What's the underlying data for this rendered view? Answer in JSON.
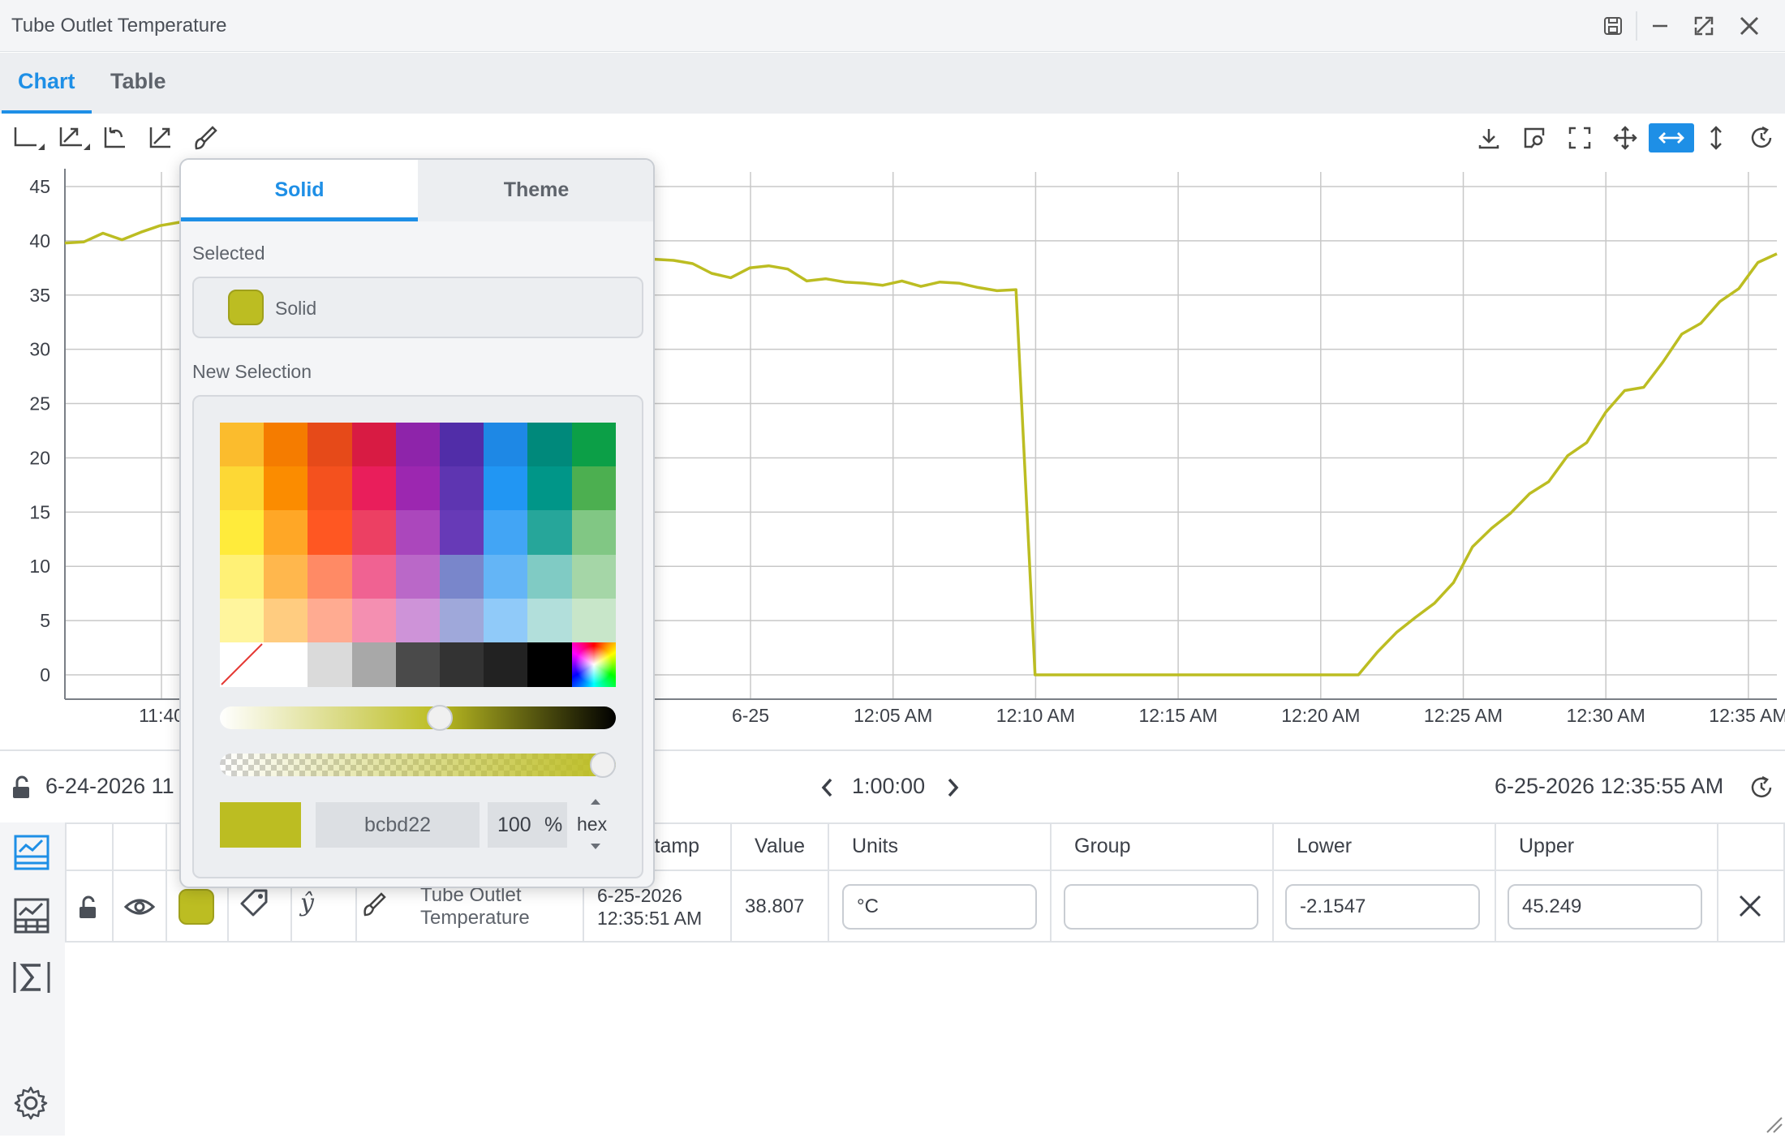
{
  "window": {
    "title": "Tube Outlet Temperature"
  },
  "tabs": [
    {
      "label": "Chart",
      "active": true
    },
    {
      "label": "Table",
      "active": false
    }
  ],
  "toolbar": {
    "left_icons": [
      "axis-icon",
      "axis-auto-icon",
      "undo-zoom-icon",
      "expand-axis-icon",
      "brush-icon"
    ],
    "right_icons": [
      "download-icon",
      "inspect-icon",
      "fullscreen-icon",
      "pan-icon",
      "horizontal-zoom-icon",
      "vertical-zoom-icon",
      "refresh-icon"
    ],
    "active_right": "horizontal-zoom-icon"
  },
  "chart_data": {
    "type": "line",
    "title": "",
    "xlabel": "",
    "ylabel": "",
    "ylim": [
      0,
      45
    ],
    "yticks": [
      "45",
      "40",
      "35",
      "30",
      "25",
      "20",
      "15",
      "10",
      "5",
      "0"
    ],
    "xticks": [
      "11:40",
      "6-25",
      "12:05 AM",
      "12:10 AM",
      "12:15 AM",
      "12:20 AM",
      "12:25 AM",
      "12:30 AM",
      "12:35 AM"
    ],
    "grid": true,
    "series": [
      {
        "color": "#bcbd22",
        "x_minutes_label": [
          "11:35:55 PM",
          "12:35:55 AM"
        ],
        "values": [
          39.8,
          39.9,
          40.7,
          40.1,
          40.8,
          41.4,
          41.7,
          41.1,
          41.1,
          40.4,
          40.6,
          40.0,
          40.1,
          40.0,
          40.2,
          39.9,
          40.0,
          40.1,
          40.0,
          39.5,
          38.6,
          38.6,
          38.5,
          39.1,
          39.0,
          38.7,
          37.7,
          38.3,
          38.0,
          37.8,
          38.4,
          38.3,
          38.2,
          37.9,
          37.0,
          36.6,
          37.5,
          37.7,
          37.4,
          36.3,
          36.5,
          36.2,
          36.1,
          35.9,
          36.3,
          35.8,
          36.2,
          36.1,
          35.7,
          35.4,
          35.5,
          0.0,
          0.0,
          0.0,
          0.0,
          0.0,
          0.0,
          0.0,
          0.0,
          0.0,
          0.0,
          0.0,
          0.0,
          0.0,
          0.0,
          0.0,
          0.0,
          0.0,
          0.0,
          2.1,
          3.9,
          5.3,
          6.6,
          8.5,
          11.8,
          13.5,
          14.9,
          16.7,
          17.8,
          20.2,
          21.4,
          24.2,
          26.2,
          26.5,
          28.8,
          31.4,
          32.4,
          34.4,
          35.6,
          38.0,
          38.8
        ]
      }
    ]
  },
  "range": {
    "start": "6-24-2026 11",
    "duration": "1:00:00",
    "end": "6-25-2026 12:35:55 AM"
  },
  "table": {
    "headers": [
      "stamp",
      "Value",
      "Units",
      "Group",
      "Lower",
      "Upper"
    ],
    "row": {
      "name": "Tube Outlet Temperature",
      "name_line1": "Tube Outlet",
      "name_line2": "Temperature",
      "timestamp_line1": "6-25-2026",
      "timestamp_line2": "12:35:51 AM",
      "value": "38.807",
      "units": "°C",
      "group": "",
      "lower": "-2.1547",
      "upper": "45.249",
      "color": "#bcbd22"
    }
  },
  "color_popup": {
    "tabs": [
      "Solid",
      "Theme"
    ],
    "active_tab": "Solid",
    "selected_label": "Selected",
    "selected_name": "Solid",
    "new_selection_label": "New Selection",
    "hex_value": "bcbd22",
    "opacity": "100",
    "percent": "%",
    "format": "hex",
    "shade_level": 0.56,
    "alpha_level": 1.0,
    "palette": [
      [
        "#fbbc2d",
        "#f57c00",
        "#e64a19",
        "#d81b43",
        "#8e24aa",
        "#512da8",
        "#1e88e5",
        "#00897b",
        "#0c9f47"
      ],
      [
        "#fdd835",
        "#fb8c00",
        "#f4511e",
        "#e91e5b",
        "#9c27b0",
        "#5e35b1",
        "#2196f3",
        "#009688",
        "#4caf50"
      ],
      [
        "#ffeb3b",
        "#ffa726",
        "#ff5722",
        "#ec4063",
        "#ab47bc",
        "#673ab7",
        "#42a5f5",
        "#26a69a",
        "#81c784"
      ],
      [
        "#fff176",
        "#ffb74d",
        "#ff8a65",
        "#f06292",
        "#ba68c8",
        "#7986cb",
        "#64b5f6",
        "#80cbc4",
        "#a5d6a7"
      ],
      [
        "#fff59d",
        "#ffcc80",
        "#ffab91",
        "#f48fb1",
        "#ce93d8",
        "#9fa8da",
        "#90caf9",
        "#b2dfdb",
        "#c8e6c9"
      ],
      [
        "none",
        "#ffffff",
        "#dadada",
        "#a8a8a8",
        "#4a4a4a",
        "#333333",
        "#222222",
        "#000000",
        "spectrum"
      ]
    ]
  }
}
